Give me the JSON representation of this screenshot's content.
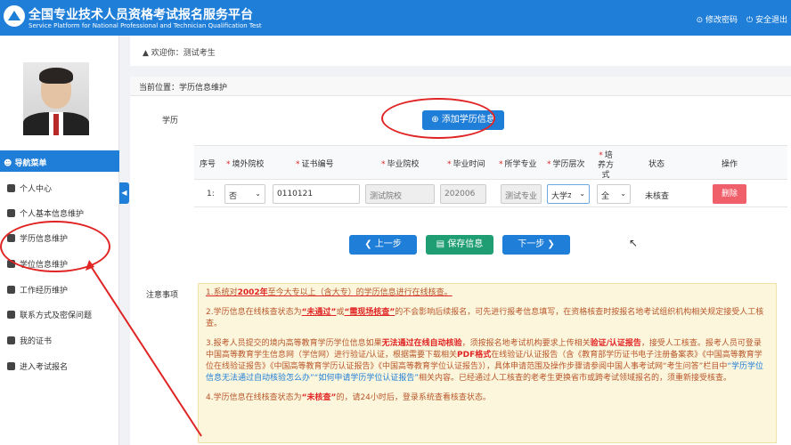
{
  "header": {
    "title_cn": "全国专业技术人员资格考试报名服务平台",
    "title_en": "Service Platform for National Professional and Technician Qualification Test",
    "change_password": "修改密码",
    "logout": "安全退出"
  },
  "sidebar": {
    "nav_title": "导航菜单",
    "items": [
      {
        "label": "个人中心"
      },
      {
        "label": "个人基本信息维护"
      },
      {
        "label": "学历信息维护"
      },
      {
        "label": "学位信息维护"
      },
      {
        "label": "工作经历维护"
      },
      {
        "label": "联系方式及密保问题"
      },
      {
        "label": "我的证书"
      },
      {
        "label": "进入考试报名"
      }
    ]
  },
  "welcome": "欢迎你：测试考生",
  "breadcrumb": "当前位置：学历信息维护",
  "section_label": "学历",
  "add_button": "添加学历信息",
  "table": {
    "headers": [
      "序号",
      "境外院校",
      "证书编号",
      "毕业院校",
      "毕业时间",
      "所学专业",
      "学历层次",
      "培养方式",
      "状态",
      "操作"
    ],
    "row": {
      "index": "1:",
      "overseas": "否",
      "cert_no": "0110121",
      "school": "测试院校",
      "grad_time": "202006",
      "major": "测试专业",
      "level": "大学本科",
      "mode": "全",
      "status": "未核查",
      "delete": "删除"
    }
  },
  "buttons": {
    "prev": "上一步",
    "save": "保存信息",
    "next": "下一步"
  },
  "notes_label": "注意事项",
  "notes": {
    "n1": {
      "a": "1.系统对",
      "b": "2002年",
      "c": "至今大专以上（含大专）的学历信息进行在线核查。"
    },
    "n2": {
      "a": "2.学历信息在线核查状态为",
      "b": "“未通过”",
      "c": "或",
      "d": "“需现场核查”",
      "e": "的不会影响后续报名，可先进行报考信息填写，在资格核查时按报名地考试组织机构相关规定接受人工核查。"
    },
    "n3": {
      "a": "3.报考人员提交的境内高等教育学历学位信息如果",
      "b": "无法通过在线自动核验",
      "c": "，须按报名地考试机构要求上传相关",
      "d": "验证/认证报告",
      "e": "，接受人工核查。报考人员可登录中国高等教育学生信息网（学信网）进行验证/认证，根据需要下载相关",
      "f": "PDF格式",
      "g": "在线验证/认证报告（含《教育部学历证书电子注册备案表》《中国高等教育学位在线验证报告》《中国高等教育学历认证报告》《中国高等教育学位认证报告》），具体申请范围及操作步骤请参阅中国人事考试网“考生问答”栏目中",
      "h": "“学历学位信息无法通过自动核验怎么办”“如何申请学历学位认证报告”",
      "i": "相关内容。已经通过人工核查的老考生更换省市或跨考试领域报名的，须重新接受核查。"
    },
    "n4": {
      "a": "4.学历信息在线核查状态为",
      "b": "“未核查”",
      "c": "的，请24小时后，登录系统查看核查状态。"
    }
  }
}
